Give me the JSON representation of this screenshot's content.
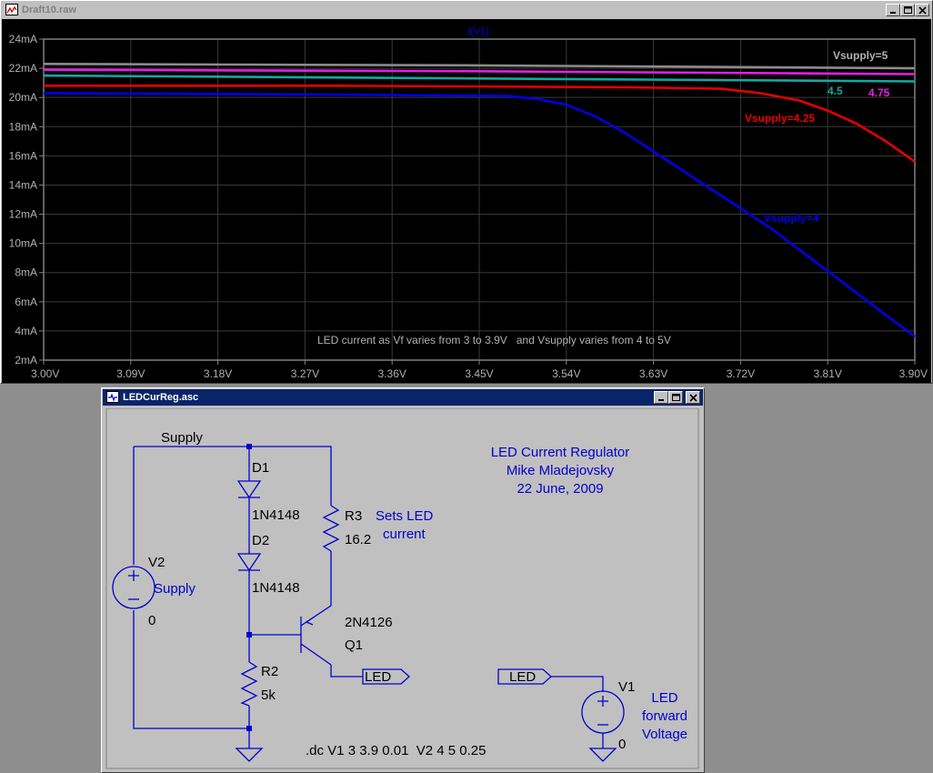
{
  "plot_window": {
    "title": "Draft10.raw",
    "trace_name": "I(V1)",
    "y_ticks": [
      "24mA",
      "22mA",
      "20mA",
      "18mA",
      "16mA",
      "14mA",
      "12mA",
      "10mA",
      "8mA",
      "6mA",
      "4mA",
      "2mA"
    ],
    "x_ticks": [
      "3.00V",
      "3.09V",
      "3.18V",
      "3.27V",
      "3.36V",
      "3.45V",
      "3.54V",
      "3.63V",
      "3.72V",
      "3.81V",
      "3.90V"
    ],
    "annotation": "LED current as Vf varies from 3 to 3.9V   and Vsupply varies from 4 to 5V",
    "labels": {
      "v5": "Vsupply=5",
      "v45": "4.5",
      "v475": "4.75",
      "v425": "Vsupply=4.25",
      "v4": "Vsupply=4"
    },
    "colors": {
      "background": "#000000",
      "grid": "#3a3a3a",
      "axes": "#808080",
      "v5": "#8c8c8c",
      "v475": "#e61ee6",
      "v45": "#14a8a0",
      "v425": "#e60000",
      "v4": "#0000e6"
    }
  },
  "chart_data": {
    "type": "line",
    "title": "I(V1)",
    "xlabel": "",
    "ylabel": "",
    "xlim": [
      3.0,
      3.9
    ],
    "ylim": [
      2,
      24
    ],
    "x_unit": "V",
    "y_unit": "mA",
    "grid": true,
    "series": [
      {
        "name": "Vsupply=5",
        "x": [
          3.0,
          3.45,
          3.9
        ],
        "y": [
          22.3,
          22.2,
          22.0
        ]
      },
      {
        "name": "4.75",
        "x": [
          3.0,
          3.45,
          3.9
        ],
        "y": [
          21.9,
          21.8,
          21.6
        ]
      },
      {
        "name": "4.5",
        "x": [
          3.0,
          3.45,
          3.9
        ],
        "y": [
          21.5,
          21.3,
          21.1
        ]
      },
      {
        "name": "Vsupply=4.25",
        "x": [
          3.0,
          3.3,
          3.6,
          3.7,
          3.74,
          3.78,
          3.81,
          3.84,
          3.87,
          3.9
        ],
        "y": [
          20.8,
          20.8,
          20.7,
          20.6,
          20.3,
          19.8,
          19.1,
          18.2,
          17.0,
          15.6
        ]
      },
      {
        "name": "Vsupply=4",
        "x": [
          3.0,
          3.3,
          3.48,
          3.51,
          3.54,
          3.57,
          3.6,
          3.63,
          3.66,
          3.69,
          3.72,
          3.75,
          3.78,
          3.81,
          3.84,
          3.87,
          3.9
        ],
        "y": [
          20.3,
          20.2,
          20.1,
          19.9,
          19.5,
          18.7,
          17.6,
          16.3,
          15.0,
          13.7,
          12.4,
          11.1,
          9.6,
          8.1,
          6.6,
          5.1,
          3.6
        ]
      }
    ]
  },
  "schematic_window": {
    "title": "LEDCurReg.asc",
    "labels": {
      "supply_net": "Supply",
      "d1": "D1",
      "d1_model": "1N4148",
      "d2": "D2",
      "d2_model": "1N4148",
      "r3": "R3",
      "r3_value": "16.2",
      "sets_led": "Sets LED",
      "current": "current",
      "v2": "V2",
      "v2_name": "Supply",
      "v2_value": "0",
      "q1_model": "2N4126",
      "q1": "Q1",
      "r2": "R2",
      "r2_value": "5k",
      "led_net": "LED",
      "led_net2": "LED",
      "v1": "V1",
      "v1_value": "0",
      "led_fv_1": "LED",
      "led_fv_2": "forward",
      "led_fv_3": "Voltage",
      "title1": "LED Current Regulator",
      "title2": "Mike Mladejovsky",
      "title3": "22 June, 2009",
      "directive": ".dc V1 3 3.9 0.01  V2 4 5 0.25"
    },
    "colors": {
      "wire": "#0000cc",
      "text": "#000000",
      "comment": "#0000cc",
      "background": "#c0c0c0"
    }
  }
}
